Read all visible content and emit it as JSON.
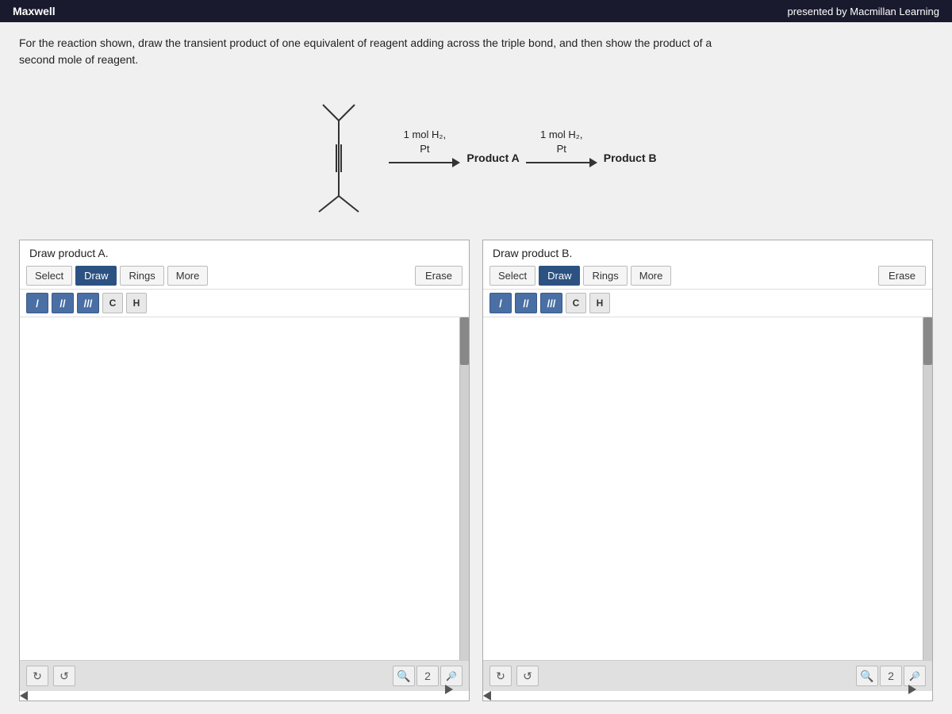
{
  "topbar": {
    "brand": "Maxwell",
    "publisher": "presented by Macmillan Learning"
  },
  "instruction": {
    "text": "For the reaction shown, draw the transient product of one equivalent of reagent adding across the triple bond, and then show the product of a second mole of reagent."
  },
  "reaction": {
    "reagent1_line1": "1 mol H₂,",
    "reagent1_line2": "Pt",
    "reagent2_line1": "1 mol H₂,",
    "reagent2_line2": "Pt",
    "product_a_label": "Product A",
    "product_b_label": "Product B"
  },
  "panel_a": {
    "title": "Draw product A.",
    "toolbar": {
      "select_label": "Select",
      "draw_label": "Draw",
      "rings_label": "Rings",
      "more_label": "More",
      "erase_label": "Erase",
      "bond_single": "/",
      "bond_double": "//",
      "bond_triple": "///",
      "atom_c": "C",
      "atom_h": "H"
    }
  },
  "panel_b": {
    "title": "Draw product B.",
    "toolbar": {
      "select_label": "Select",
      "draw_label": "Draw",
      "rings_label": "Rings",
      "more_label": "More",
      "erase_label": "Erase",
      "bond_single": "/",
      "bond_double": "//",
      "bond_triple": "///",
      "atom_c": "C",
      "atom_h": "H"
    }
  },
  "icons": {
    "undo": "↺",
    "redo": "↻",
    "zoom_in": "🔍",
    "zoom_reset": "2",
    "zoom_out": "🔍"
  }
}
